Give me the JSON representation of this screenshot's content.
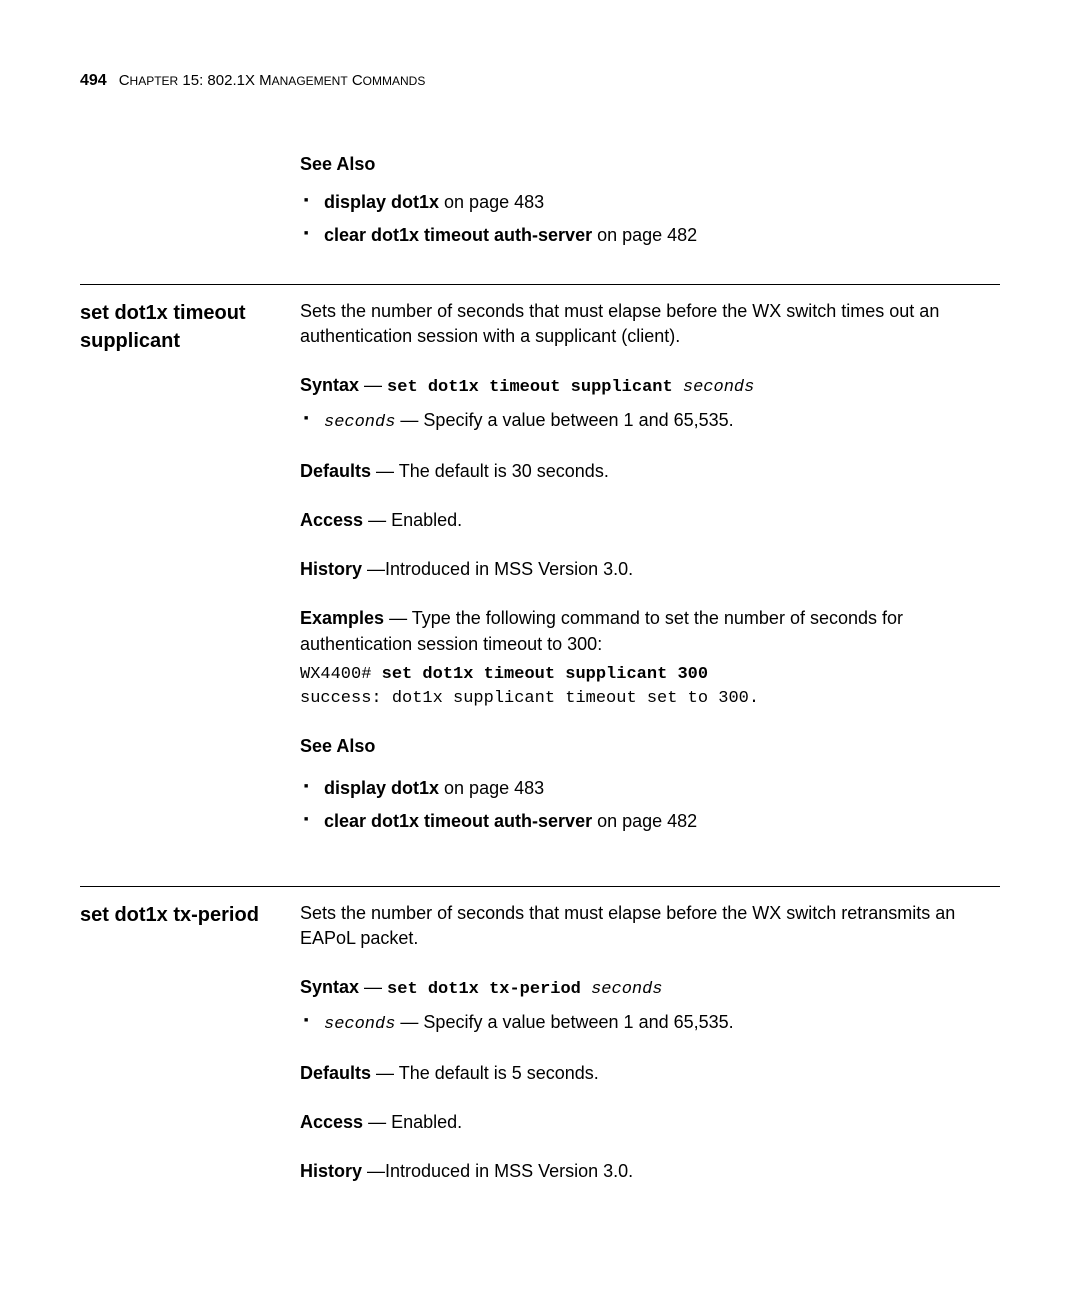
{
  "header": {
    "page_number": "494",
    "chapter_prefix": "C",
    "chapter_text": "HAPTER",
    "chapter_num": " 15: 802.1X M",
    "chapter_tail": "ANAGEMENT",
    "chapter_cmd_prefix": " C",
    "chapter_cmd": "OMMANDS"
  },
  "seealso1": {
    "title": "See Also",
    "item1_bold": "display dot1x",
    "item1_tail": " on page 483",
    "item2_bold": "clear dot1x timeout auth-server",
    "item2_tail": " on page 482"
  },
  "section_supplicant": {
    "title_line1": "set dot1x timeout",
    "title_line2": "supplicant",
    "intro": "Sets the number of seconds that must elapse before the WX switch times out an authentication session with a supplicant (client).",
    "syntax_label": "Syntax",
    "syntax_dash": " — ",
    "syntax_cmd": "set dot1x timeout supplicant ",
    "syntax_param": "seconds",
    "param_name": "seconds",
    "param_desc": " — Specify a value between 1 and 65,535.",
    "defaults_label": "Defaults",
    "defaults_text": " — The default is 30 seconds.",
    "access_label": "Access",
    "access_text": " — Enabled.",
    "history_label": "History",
    "history_text": " —Introduced in MSS Version 3.0.",
    "examples_label": "Examples",
    "examples_text": " — Type the following command to set the number of seconds for authentication session timeout to 300:",
    "code_prompt": "WX4400# ",
    "code_cmd": "set dot1x timeout supplicant 300",
    "code_output": "success: dot1x supplicant timeout set to 300.",
    "seealso_title": "See Also",
    "seealso_item1_bold": "display dot1x",
    "seealso_item1_tail": " on page 483",
    "seealso_item2_bold": "clear dot1x timeout auth-server",
    "seealso_item2_tail": " on page 482"
  },
  "section_txperiod": {
    "title": "set dot1x tx-period",
    "intro": "Sets the number of seconds that must elapse before the WX switch retransmits an EAPoL packet.",
    "syntax_label": "Syntax",
    "syntax_dash": " — ",
    "syntax_cmd": "set dot1x tx-period ",
    "syntax_param": "seconds",
    "param_name": "seconds",
    "param_desc": " — Specify a value between 1 and 65,535.",
    "defaults_label": "Defaults",
    "defaults_text": " — The default is 5 seconds.",
    "access_label": "Access",
    "access_text": " — Enabled.",
    "history_label": "History",
    "history_text": " —Introduced in MSS Version 3.0."
  }
}
